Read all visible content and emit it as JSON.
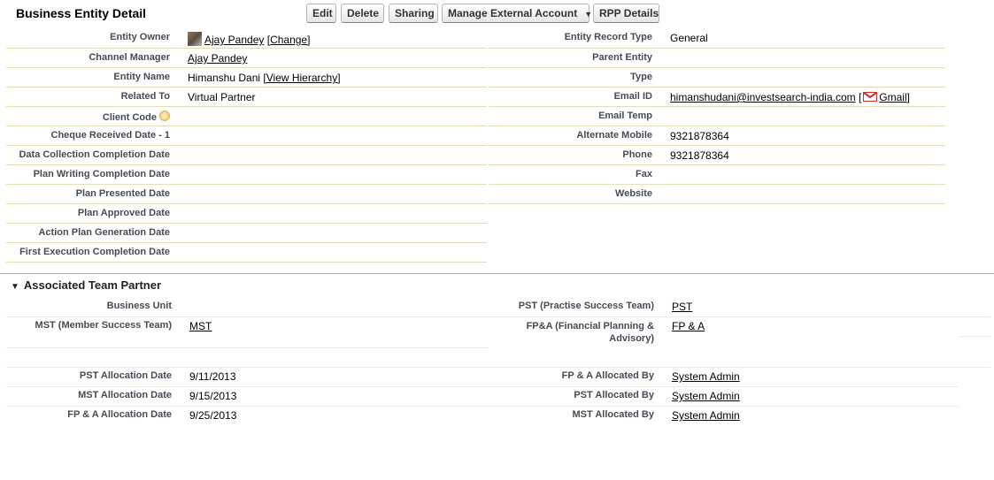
{
  "header": {
    "title": "Business Entity Detail",
    "buttons": {
      "edit": "Edit",
      "delete": "Delete",
      "sharing": "Sharing",
      "manage_external": "Manage External Account",
      "rpp": "RPP Details"
    }
  },
  "detail": {
    "entity_owner": {
      "label": "Entity Owner",
      "value": "Ajay Pandey",
      "action": "[Change]"
    },
    "channel_manager": {
      "label": "Channel Manager",
      "value": "Ajay Pandey"
    },
    "entity_name": {
      "label": "Entity Name",
      "value": "Himanshu Dani",
      "action": "[View Hierarchy]"
    },
    "related_to": {
      "label": "Related To",
      "value": "Virtual Partner"
    },
    "client_code": {
      "label": "Client Code",
      "value": ""
    },
    "cheque_received": {
      "label": "Cheque Received Date - 1",
      "value": ""
    },
    "data_collection": {
      "label": "Data Collection Completion Date",
      "value": ""
    },
    "plan_writing": {
      "label": "Plan Writing Completion Date",
      "value": ""
    },
    "plan_presented": {
      "label": "Plan Presented Date",
      "value": ""
    },
    "plan_approved": {
      "label": "Plan Approved Date",
      "value": ""
    },
    "action_plan": {
      "label": "Action Plan Generation Date",
      "value": ""
    },
    "first_execution": {
      "label": "First Execution Completion Date",
      "value": ""
    },
    "entity_record_type": {
      "label": "Entity Record Type",
      "value": "General"
    },
    "parent_entity": {
      "label": "Parent Entity",
      "value": ""
    },
    "type": {
      "label": "Type",
      "value": ""
    },
    "email_id": {
      "label": "Email ID",
      "value": "himanshudani@investsearch-india.com",
      "gmail": "Gmail"
    },
    "email_temp": {
      "label": "Email Temp",
      "value": ""
    },
    "alternate_mobile": {
      "label": "Alternate Mobile",
      "value": "9321878364"
    },
    "phone": {
      "label": "Phone",
      "value": "9321878364"
    },
    "fax": {
      "label": "Fax",
      "value": ""
    },
    "website": {
      "label": "Website",
      "value": ""
    }
  },
  "team": {
    "section_title": "Associated Team Partner",
    "business_unit": {
      "label": "Business Unit",
      "value": ""
    },
    "mst": {
      "label": "MST (Member Success Team)",
      "value": "MST"
    },
    "pst": {
      "label": "PST (Practise Success Team)",
      "value": "PST"
    },
    "fpa": {
      "label": "FP&A (Financial Planning & Advisory)",
      "value": "FP & A"
    },
    "pst_alloc_date": {
      "label": "PST Allocation Date",
      "value": "9/11/2013"
    },
    "mst_alloc_date": {
      "label": "MST Allocation Date",
      "value": "9/15/2013"
    },
    "fpa_alloc_date": {
      "label": "FP & A Allocation Date",
      "value": "9/25/2013"
    },
    "fpa_alloc_by": {
      "label": "FP & A Allocated By",
      "value": "System Admin"
    },
    "pst_alloc_by": {
      "label": "PST Allocated By",
      "value": "System Admin"
    },
    "mst_alloc_by": {
      "label": "MST Allocated By",
      "value": "System Admin"
    }
  },
  "colors": {
    "label_text": "#4a4a56",
    "section_rule": "#9dbf77",
    "row_rule": "#e3deb8"
  },
  "icons": [
    "user-avatar-icon",
    "info-bulb-icon",
    "gmail-icon",
    "expand-triangle-icon",
    "dropdown-caret-icon"
  ]
}
